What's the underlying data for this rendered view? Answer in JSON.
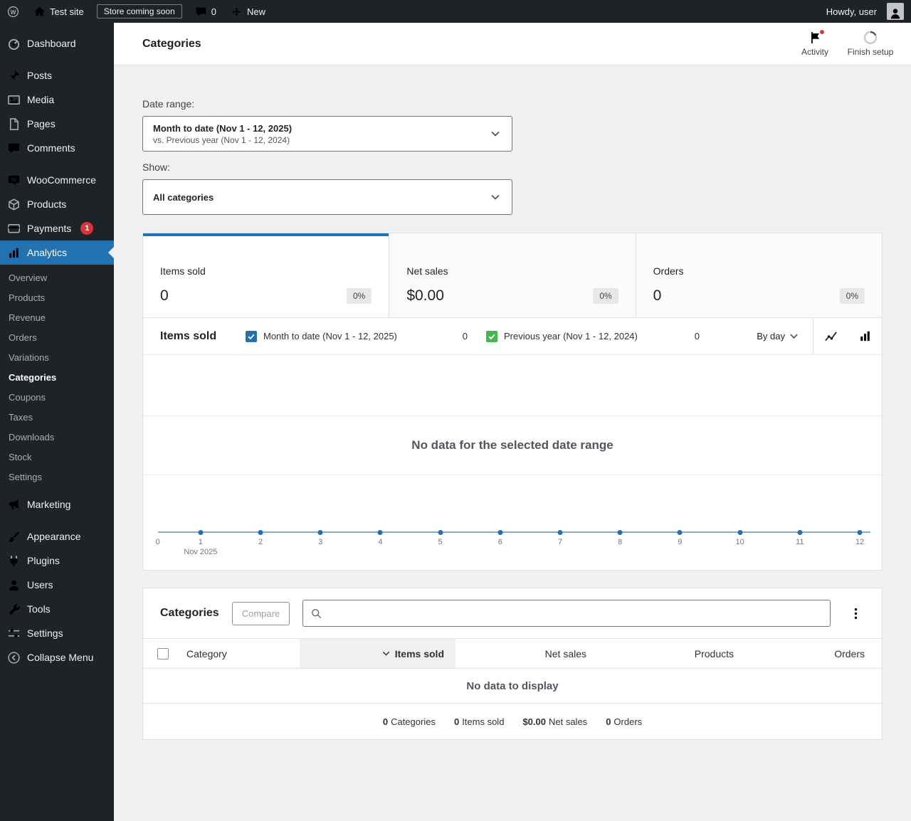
{
  "admin_bar": {
    "site_name": "Test site",
    "coming_soon_badge": "Store coming soon",
    "comment_count": "0",
    "new_label": "New",
    "howdy": "Howdy, user"
  },
  "sidebar": {
    "items": [
      {
        "label": "Dashboard"
      },
      {
        "label": "Posts"
      },
      {
        "label": "Media"
      },
      {
        "label": "Pages"
      },
      {
        "label": "Comments"
      },
      {
        "label": "WooCommerce"
      },
      {
        "label": "Products"
      },
      {
        "label": "Payments",
        "badge": "1"
      },
      {
        "label": "Analytics"
      },
      {
        "label": "Marketing"
      },
      {
        "label": "Appearance"
      },
      {
        "label": "Plugins"
      },
      {
        "label": "Users"
      },
      {
        "label": "Tools"
      },
      {
        "label": "Settings"
      },
      {
        "label": "Collapse Menu"
      }
    ],
    "analytics_submenu": [
      "Overview",
      "Products",
      "Revenue",
      "Orders",
      "Variations",
      "Categories",
      "Coupons",
      "Taxes",
      "Downloads",
      "Stock",
      "Settings"
    ]
  },
  "page_header": {
    "title": "Categories",
    "activity": "Activity",
    "finish_setup": "Finish setup"
  },
  "filters": {
    "date_range_label": "Date range:",
    "date_range_primary": "Month to date (Nov 1 - 12, 2025)",
    "date_range_secondary": "vs. Previous year (Nov 1 - 12, 2024)",
    "show_label": "Show:",
    "show_value": "All categories"
  },
  "summary": {
    "cards": [
      {
        "label": "Items sold",
        "value": "0",
        "delta": "0%"
      },
      {
        "label": "Net sales",
        "value": "$0.00",
        "delta": "0%"
      },
      {
        "label": "Orders",
        "value": "0",
        "delta": "0%"
      }
    ]
  },
  "chart": {
    "title": "Items sold",
    "legend": [
      {
        "label": "Month to date (Nov 1 - 12, 2025)",
        "value": "0"
      },
      {
        "label": "Previous year (Nov 1 - 12, 2024)",
        "value": "0"
      }
    ],
    "interval": "By day",
    "empty_message": "No data for the selected date range",
    "y_zero_label": "0",
    "x_ticks": [
      "1",
      "2",
      "3",
      "4",
      "5",
      "6",
      "7",
      "8",
      "9",
      "10",
      "11",
      "12"
    ],
    "x_axis_sublabel": "Nov 2025"
  },
  "chart_data": {
    "type": "line",
    "title": "Items sold",
    "x": [
      1,
      2,
      3,
      4,
      5,
      6,
      7,
      8,
      9,
      10,
      11,
      12
    ],
    "xlabel": "Nov 2025",
    "ylabel": "",
    "ylim": [
      0,
      3
    ],
    "series": [
      {
        "name": "Month to date (Nov 1 - 12, 2025)",
        "values": [
          0,
          0,
          0,
          0,
          0,
          0,
          0,
          0,
          0,
          0,
          0,
          0
        ],
        "color": "#2271b1"
      },
      {
        "name": "Previous year (Nov 1 - 12, 2024)",
        "values": [
          0,
          0,
          0,
          0,
          0,
          0,
          0,
          0,
          0,
          0,
          0,
          0
        ],
        "color": "#46b450"
      }
    ],
    "annotations": [
      "No data for the selected date range"
    ],
    "legend_position": "top",
    "grid": true
  },
  "table": {
    "title": "Categories",
    "compare_label": "Compare",
    "search_value": "",
    "columns": [
      "Category",
      "Items sold",
      "Net sales",
      "Products",
      "Orders"
    ],
    "sorted_column": "Items sold",
    "empty_message": "No data to display",
    "totals": [
      {
        "value": "0",
        "label": "Categories"
      },
      {
        "value": "0",
        "label": "Items sold"
      },
      {
        "value": "$0.00",
        "label": "Net sales"
      },
      {
        "value": "0",
        "label": "Orders"
      }
    ]
  },
  "colors": {
    "accent": "#2271b1",
    "secondary_series": "#46b450",
    "notification_red": "#d63638"
  }
}
